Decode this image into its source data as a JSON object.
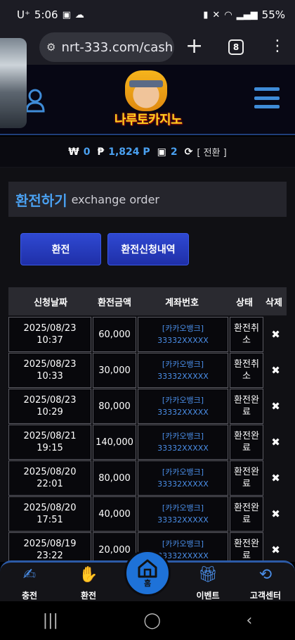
{
  "status_bar": {
    "carrier": "U⁺",
    "time": "5:06",
    "battery": "55%"
  },
  "browser": {
    "url": "nrt-333.com/cash",
    "tab_count": "8"
  },
  "site": {
    "logo_text": "나루토카지노"
  },
  "balance": {
    "cash_symbol": "₩",
    "cash_value": "0",
    "point_symbol": "₱",
    "point_value": "1,824 P",
    "chip_value": "2",
    "convert_label": "[ 전환 ]"
  },
  "section": {
    "title_ko": "환전하기",
    "title_en": "exchange order"
  },
  "buttons": {
    "exchange": "환전",
    "history": "환전신청내역"
  },
  "table": {
    "headers": [
      "신청날짜",
      "환전금액",
      "계좌번호",
      "상태",
      "삭제"
    ],
    "rows": [
      {
        "date": "2025/08/23",
        "time": "10:37",
        "amount": "60,000",
        "bank": "[카카오뱅크]",
        "account": "33332XXXXX",
        "status": "환전취소",
        "del": "✖"
      },
      {
        "date": "2025/08/23",
        "time": "10:33",
        "amount": "30,000",
        "bank": "[카카오뱅크]",
        "account": "33332XXXXX",
        "status": "환전취소",
        "del": "✖"
      },
      {
        "date": "2025/08/23",
        "time": "10:29",
        "amount": "80,000",
        "bank": "[카카오뱅크]",
        "account": "33332XXXXX",
        "status": "환전완료",
        "del": "✖"
      },
      {
        "date": "2025/08/21",
        "time": "19:15",
        "amount": "140,000",
        "bank": "[카카오뱅크]",
        "account": "33332XXXXX",
        "status": "환전완료",
        "del": "✖"
      },
      {
        "date": "2025/08/20",
        "time": "22:01",
        "amount": "80,000",
        "bank": "[카카오뱅크]",
        "account": "33332XXXXX",
        "status": "환전완료",
        "del": "✖"
      },
      {
        "date": "2025/08/20",
        "time": "17:51",
        "amount": "40,000",
        "bank": "[카카오뱅크]",
        "account": "33332XXXXX",
        "status": "환전완료",
        "del": "✖"
      },
      {
        "date": "2025/08/19",
        "time": "23:22",
        "amount": "20,000",
        "bank": "[카카오뱅크]",
        "account": "33332XXXXX",
        "status": "환전완료",
        "del": "✖"
      }
    ]
  },
  "bottom_nav": {
    "charge": "충전",
    "exchange": "환전",
    "home": "홈",
    "event": "이벤트",
    "support": "고객센터"
  },
  "colors": {
    "accent": "#4aa0f0",
    "button": "#2a40c8",
    "home": "#1e72d8"
  }
}
